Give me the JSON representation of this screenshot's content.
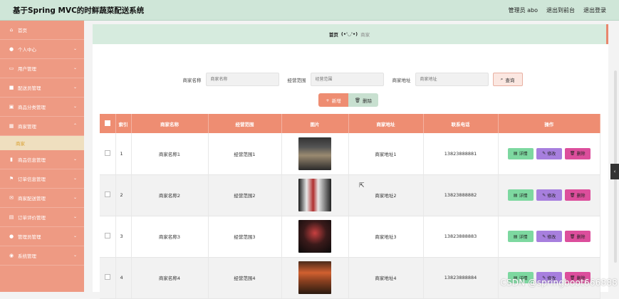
{
  "app": {
    "title": "基于Spring MVC的时鲜蔬菜配送系统"
  },
  "header": {
    "admin": "管理员 abo",
    "front": "退出到前台",
    "logout": "退出登录"
  },
  "sidebar": {
    "items": [
      {
        "label": "首页",
        "icon": "home-icon"
      },
      {
        "label": "个人中心",
        "icon": "user-icon"
      },
      {
        "label": "用户管理",
        "icon": "users-icon"
      },
      {
        "label": "配送员管理",
        "icon": "briefcase-icon"
      },
      {
        "label": "商品分类管理",
        "icon": "clipboard-icon"
      },
      {
        "label": "商家管理",
        "icon": "grid-icon"
      },
      {
        "label": "商品信息管理",
        "icon": "bar-chart-icon"
      },
      {
        "label": "订单信息管理",
        "icon": "flag-icon"
      },
      {
        "label": "商家配送管理",
        "icon": "mail-icon"
      },
      {
        "label": "订单评价管理",
        "icon": "calendar-icon"
      },
      {
        "label": "管理员管理",
        "icon": "admin-icon"
      },
      {
        "label": "系统管理",
        "icon": "pin-icon"
      }
    ],
    "active_sub": "商家"
  },
  "breadcrumb": {
    "home": "首页",
    "face": "(•'◡'•)",
    "current": "商家"
  },
  "search": {
    "name_label": "商家名称",
    "name_placeholder": "商家名称",
    "scope_label": "经营范围",
    "scope_placeholder": "经营范围",
    "addr_label": "商家地址",
    "addr_placeholder": "商家地址",
    "query": "查询"
  },
  "actions": {
    "add": "新增",
    "delete": "删除"
  },
  "table": {
    "headers": [
      "索引",
      "商家名称",
      "经营范围",
      "图片",
      "商家地址",
      "联系电话",
      "操作"
    ],
    "rows": [
      {
        "idx": "1",
        "name": "商家名称1",
        "scope": "经营范围1",
        "addr": "商家地址1",
        "phone": "13823888881"
      },
      {
        "idx": "2",
        "name": "商家名称2",
        "scope": "经营范围2",
        "addr": "商家地址2",
        "phone": "13823888882"
      },
      {
        "idx": "3",
        "name": "商家名称3",
        "scope": "经营范围3",
        "addr": "商家地址3",
        "phone": "13823888883"
      },
      {
        "idx": "4",
        "name": "商家名称4",
        "scope": "经营范围4",
        "addr": "商家地址4",
        "phone": "13823888884"
      }
    ],
    "ops": {
      "detail": "详情",
      "edit": "修改",
      "del": "删除"
    }
  },
  "watermark": "CSDN @springboot666888",
  "colors": {
    "sidebar": "#ee9a83",
    "header": "#cfe6d8",
    "accent": "#ee8d72"
  }
}
